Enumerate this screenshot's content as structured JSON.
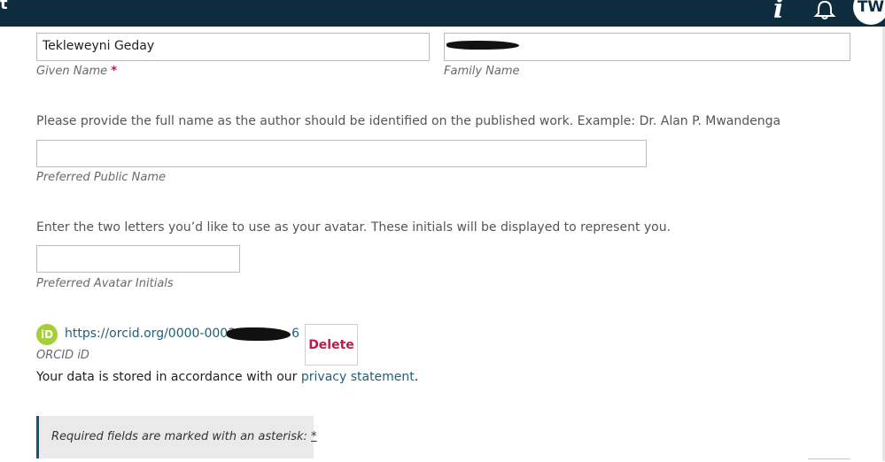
{
  "header": {
    "title_fragment": "t",
    "avatar_initials": "TW"
  },
  "form": {
    "given_name": {
      "value": "Tekleweyni Geday",
      "label": "Given Name",
      "required_mark": "*"
    },
    "family_name": {
      "value": "",
      "label": "Family Name"
    },
    "preferred_public_name": {
      "help": "Please provide the full name as the author should be identified on the published work. Example: Dr. Alan P. Mwandenga",
      "value": "",
      "label": "Preferred Public Name"
    },
    "avatar_initials": {
      "help": "Enter the two letters you’d like to use as your avatar. These initials will be displayed to represent you.",
      "value": "",
      "label": "Preferred Avatar Initials"
    },
    "orcid": {
      "icon_text": "iD",
      "url": "https://orcid.org/0000-0003-",
      "url_tail": "6",
      "label": "ORCID iD",
      "delete_label": "Delete"
    },
    "data_note": {
      "text": "Your data is stored in accordance with our ",
      "link": "privacy statement",
      "end": "."
    },
    "required_notice": {
      "text": "Required fields are marked with an asterisk: ",
      "star": "*"
    }
  },
  "colors": {
    "topbar": "#0d2d3f",
    "accent": "#c0194a",
    "link": "#1f5f7a",
    "orcid": "#a6ce39"
  }
}
